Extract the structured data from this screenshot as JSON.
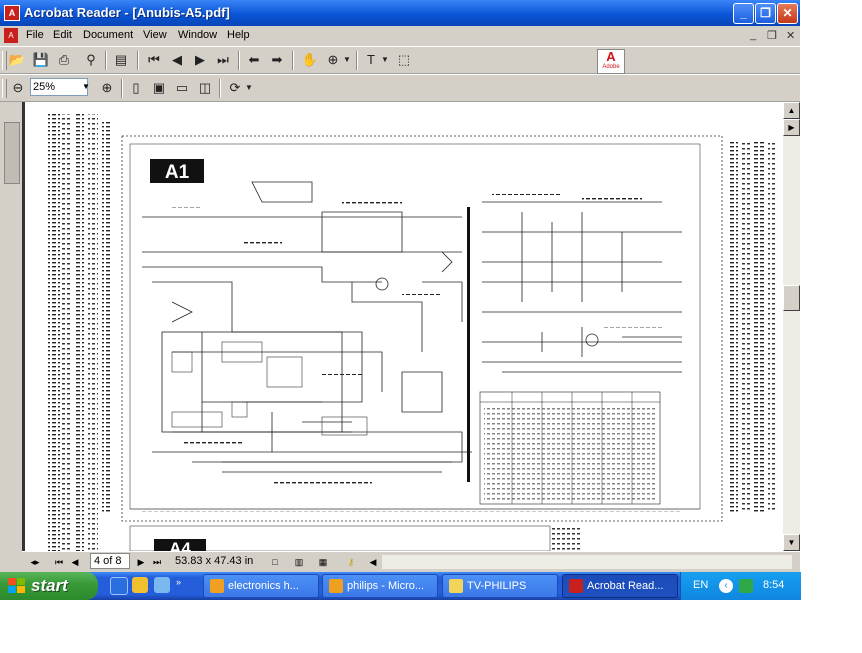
{
  "window": {
    "title": "Acrobat Reader - [Anubis-A5.pdf]"
  },
  "menu": [
    "File",
    "Edit",
    "Document",
    "View",
    "Window",
    "Help"
  ],
  "toolbar": {
    "zoom_value": "25%"
  },
  "adobe_logo": {
    "letter": "A",
    "text": "Adobe"
  },
  "document": {
    "block_label": "A1",
    "next_block_label": "A4"
  },
  "status": {
    "page": "4 of 8",
    "page_size": "53.83 x 47.43 in"
  },
  "taskbar": {
    "start_label": "start",
    "tasks": [
      {
        "label": "electronics h...",
        "icon_color": "#f0a020"
      },
      {
        "label": "philips - Micro...",
        "icon_color": "#f0a020"
      },
      {
        "label": "TV-PHILIPS",
        "icon_color": "#f2d45a"
      },
      {
        "label": "Acrobat Read...",
        "icon_color": "#c8201c"
      }
    ],
    "language": "EN",
    "time": "8:54"
  },
  "colors": {
    "title_bar": "#0a55d6",
    "taskbar": "#245edb",
    "start_button": "#3a9a3a",
    "tray": "#0f86e0"
  }
}
